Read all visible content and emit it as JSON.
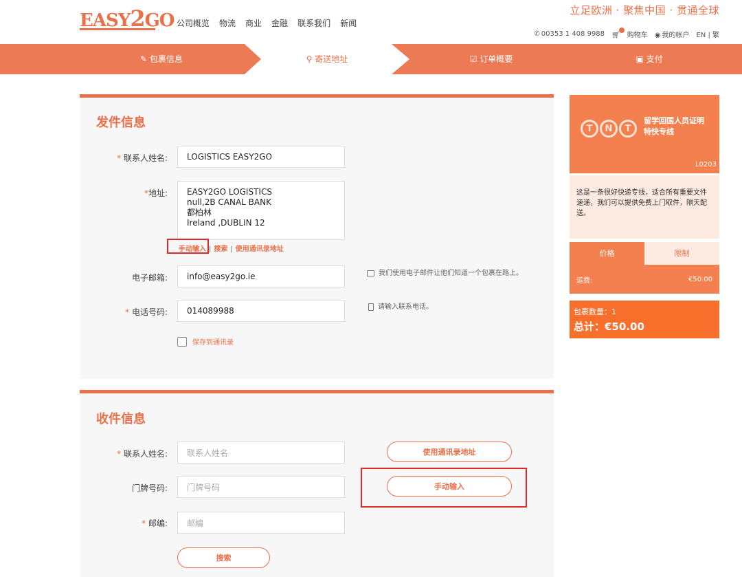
{
  "header": {
    "logo": {
      "pre": "EASY",
      "two": "2",
      "post": "GO"
    },
    "nav": [
      "公司概览",
      "物流",
      "商业",
      "金融",
      "联系我们",
      "新闻"
    ],
    "slogan": "立足欧洲 · 聚焦中国 · 贯通全球",
    "phone": "00353 1 408 9988",
    "cart": "购物车",
    "account": "我的帐户",
    "lang": "EN | 繁"
  },
  "steps": {
    "s1": "包裹信息",
    "s2": "寄送地址",
    "s3": "订单概要",
    "s4": "支付"
  },
  "sender": {
    "title": "发件信息",
    "name_label": "联系人姓名:",
    "name_value": "LOGISTICS EASY2GO",
    "addr_label": "地址:",
    "addr_lines": [
      "EASY2GO LOGISTICS",
      "null,2B CANAL BANK",
      "都柏林",
      "Ireland ,DUBLIN 12"
    ],
    "link_manual": "手动输入",
    "link_search": "搜索",
    "link_book": "使用通讯录地址",
    "sep": "|",
    "email_label": "电子邮箱:",
    "email_value": "info@easy2go.ie",
    "email_hint": "我们使用电子邮件让他们知道一个包裹在路上。",
    "phone_label": "电话号码:",
    "phone_value": "014089988",
    "phone_hint": "请输入联系电话。",
    "save_label": "保存到通讯录"
  },
  "receiver": {
    "title": "收件信息",
    "name_label": "联系人姓名:",
    "name_placeholder": "联系人姓名",
    "door_label": "门牌号码:",
    "door_placeholder": "门牌号码",
    "zip_label": "邮编:",
    "zip_placeholder": "邮编",
    "search_button": "搜索",
    "book_button": "使用通讯录地址",
    "manual_button": "手动输入"
  },
  "product": {
    "logo_letters": [
      "T",
      "N",
      "T"
    ],
    "title": "留学回国人员证明特快专线",
    "code": "L0203",
    "description": "这是一条很好快递专线，适合所有重要文件速递，我们可以提供免费上门取件，隔天配送。",
    "tab_price": "价格",
    "tab_limit": "限制",
    "fee_label": "运费:",
    "fee_value": "€50.00",
    "count": "包裹数量：1",
    "total": "总计：€50.00"
  },
  "colors": {
    "accent": "#e8704a",
    "highlight": "#e0292a"
  }
}
